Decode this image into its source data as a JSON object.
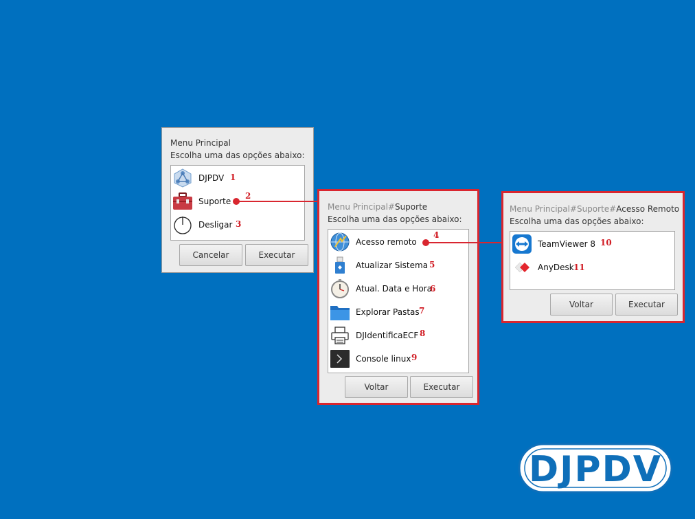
{
  "dialog1": {
    "path_prefix": "",
    "path_current": "Menu Principal",
    "subtitle": "Escolha uma das opções abaixo:",
    "items": [
      {
        "label": "DJPDV",
        "num": "1"
      },
      {
        "label": "Suporte",
        "num": "2"
      },
      {
        "label": "Desligar",
        "num": "3"
      }
    ],
    "cancel_label": "Cancelar",
    "execute_label": "Executar"
  },
  "dialog2": {
    "path_prefix": "Menu Principal#",
    "path_current": "Suporte",
    "subtitle": "Escolha uma das opções abaixo:",
    "items": [
      {
        "label": "Acesso remoto",
        "num": "4"
      },
      {
        "label": "Atualizar Sistema",
        "num": "5"
      },
      {
        "label": "Atual. Data e Hora",
        "num": "6"
      },
      {
        "label": "Explorar Pastas",
        "num": "7"
      },
      {
        "label": "DJIdentificaECF",
        "num": "8"
      },
      {
        "label": "Console linux",
        "num": "9"
      }
    ],
    "back_label": "Voltar",
    "execute_label": "Executar"
  },
  "dialog3": {
    "path_prefix": "Menu Principal#Suporte#",
    "path_current": "Acesso Remoto",
    "subtitle": "Escolha uma das opções abaixo:",
    "items": [
      {
        "label": "TeamViewer 8",
        "num": "10"
      },
      {
        "label": "AnyDesk",
        "num": "11"
      }
    ],
    "back_label": "Voltar",
    "execute_label": "Executar"
  },
  "logo": {
    "text": "DJPDV"
  },
  "colors": {
    "desktop": "#0070bf",
    "highlight": "#d9262f",
    "dialog_bg": "#ececec"
  }
}
